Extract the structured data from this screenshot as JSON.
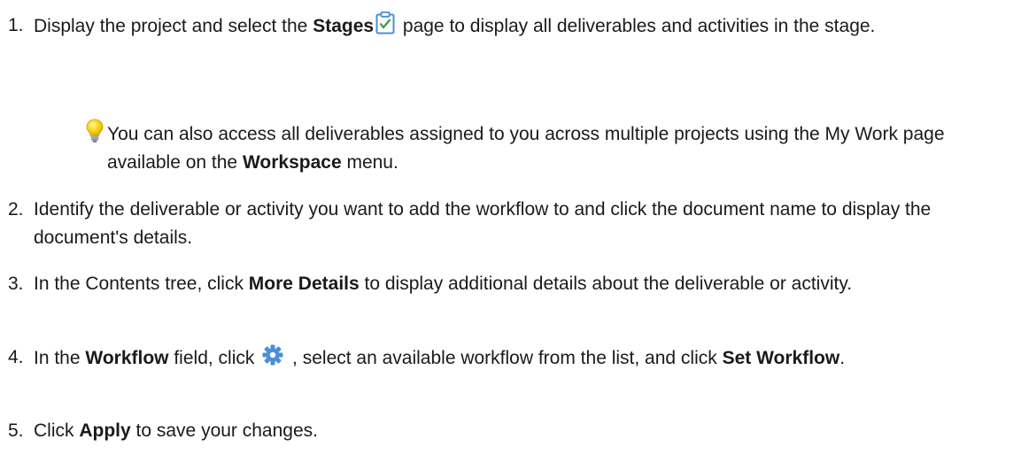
{
  "steps": [
    {
      "number": "1.",
      "text_a": "Display the project and select the ",
      "bold_a": "Stages",
      "icon": "stages-clipboard-icon",
      "text_b": " page to display all deliverables and activities in the stage."
    },
    {
      "number": "2.",
      "text_a": "Identify the deliverable or activity you want to add the workflow to and click the document name to display the document's details."
    },
    {
      "number": "3.",
      "text_a": "In the Contents tree, click ",
      "bold_a": "More Details",
      "text_b": " to display additional details about the deliverable or activity."
    },
    {
      "number": "4.",
      "text_a": "In the ",
      "bold_a": "Workflow",
      "text_b": " field, click ",
      "icon": "gear-icon",
      "text_c": " , select an available workflow from the list, and click ",
      "bold_b": "Set Workflow",
      "text_d": "."
    },
    {
      "number": "5.",
      "text_a": "Click ",
      "bold_a": "Apply",
      "text_b": " to save your changes."
    }
  ],
  "tip": {
    "icon": "lightbulb-icon",
    "text_a": "You can also access all deliverables assigned to you across multiple projects using the My Work page available on the ",
    "bold_a": "Workspace",
    "text_b": " menu."
  },
  "colors": {
    "text": "#1a1a1a",
    "icon_blue": "#4a8fd6",
    "icon_green": "#3a9a3a",
    "bulb_yellow": "#f5d000"
  }
}
